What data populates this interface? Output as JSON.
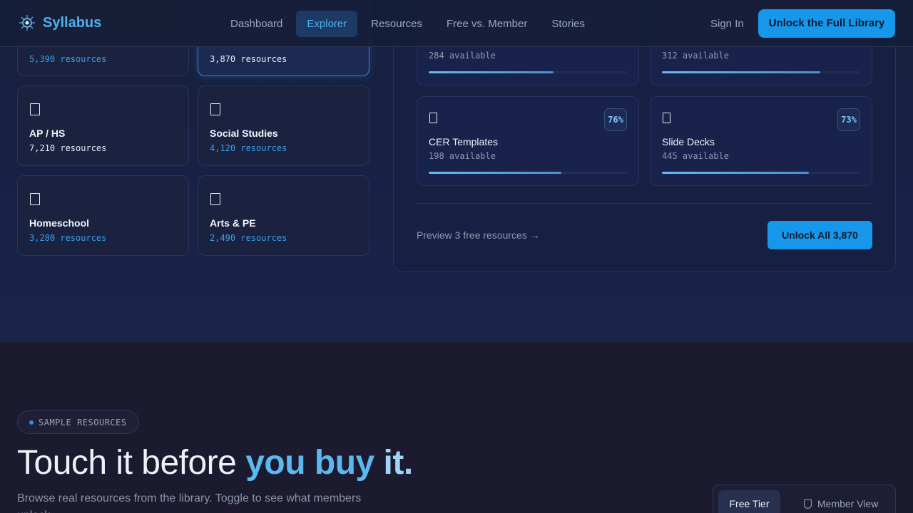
{
  "nav": {
    "brand": "Syllabus",
    "links": [
      "Dashboard",
      "Explorer",
      "Resources",
      "Free vs. Member",
      "Stories"
    ],
    "active_link": "Explorer",
    "sign_in": "Sign In",
    "cta": "Unlock the Full Library"
  },
  "categories": [
    {
      "name": "",
      "count": "5,390 resources",
      "count_color": "blue"
    },
    {
      "name": "",
      "count": "3,870 resources",
      "active": true
    },
    {
      "name": "AP / HS",
      "count": "7,210 resources"
    },
    {
      "name": "Social Studies",
      "count": "4,120 resources",
      "count_color": "blue"
    },
    {
      "name": "Homeschool",
      "count": "3,280 resources",
      "count_color": "blue"
    },
    {
      "name": "Arts & PE",
      "count": "2,490 resources",
      "count_color": "blue"
    }
  ],
  "resources": [
    {
      "name": "",
      "available": "284 available",
      "progress": 0.63
    },
    {
      "name": "",
      "available": "312 available",
      "progress": 0.8
    },
    {
      "name": "CER Templates",
      "available": "198 available",
      "percent": "76%",
      "progress": 0.67
    },
    {
      "name": "Slide Decks",
      "available": "445 available",
      "percent": "73%",
      "progress": 0.74
    }
  ],
  "panel": {
    "preview_link": "Preview 3 free resources →",
    "unlock_button": "Unlock All 3,870"
  },
  "samples": {
    "pill": "SAMPLE RESOURCES",
    "headline_start": "Touch it before ",
    "headline_accent1": "you buy ",
    "headline_accent2": "it.",
    "subtext": "Browse real resources from the library. Toggle to see what members unlock.",
    "toggle_free": "Free Tier",
    "toggle_member": "Member View"
  },
  "colors": {
    "accent": "#1697ea",
    "brand": "#4fb0f0",
    "background": "#1a1a2e"
  }
}
